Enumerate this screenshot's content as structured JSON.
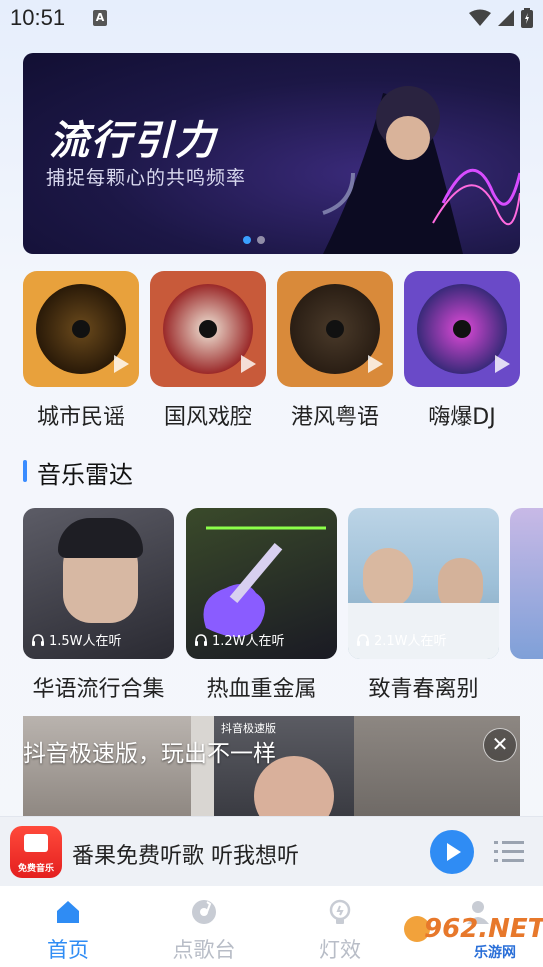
{
  "status_bar": {
    "time": "10:51",
    "notification_letter": "A"
  },
  "banner": {
    "title": "流行引力",
    "subtitle": "捕捉每颗心的共鸣频率"
  },
  "categories": [
    {
      "label": "城市民谣"
    },
    {
      "label": "国风戏腔"
    },
    {
      "label": "港风粤语"
    },
    {
      "label": "嗨爆DJ"
    }
  ],
  "section": {
    "title": "音乐雷达"
  },
  "radar": [
    {
      "count": "1.5W人在听",
      "label": "华语流行合集"
    },
    {
      "count": "1.2W人在听",
      "label": "热血重金属"
    },
    {
      "count": "2.1W人在听",
      "label": "致青春离别"
    }
  ],
  "ad": {
    "brand": "抖音极速版",
    "text": "抖音极速版，玩出不一样"
  },
  "player": {
    "logo_text": "免费音乐",
    "text": "番果免费听歌   听我想听"
  },
  "nav": [
    {
      "label": "首页",
      "icon": "home-icon"
    },
    {
      "label": "点歌台",
      "icon": "disc-icon"
    },
    {
      "label": "灯效",
      "icon": "bulb-icon"
    }
  ],
  "watermark": {
    "main": "962.NET",
    "sub": "乐游网"
  },
  "colors": {
    "accent": "#2f8cf4",
    "section_bar": "#3a8cff"
  }
}
